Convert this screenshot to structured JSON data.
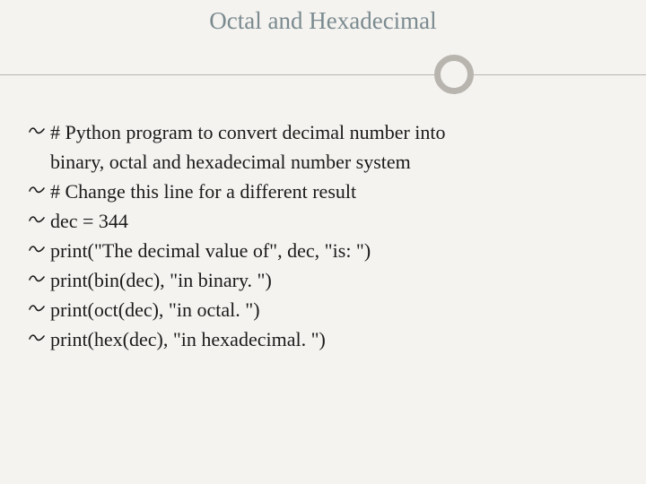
{
  "title": "Octal and Hexadecimal",
  "lines": [
    {
      "text": "# Python program to convert decimal number into",
      "bullet": true,
      "indent": false
    },
    {
      "text": "binary, octal and hexadecimal number system",
      "bullet": false,
      "indent": true
    },
    {
      "text": "# Change this line for a different result",
      "bullet": true,
      "indent": false
    },
    {
      "text": "dec = 344",
      "bullet": true,
      "indent": false
    },
    {
      "text": "print(\"The decimal value of\", dec, \"is: \")",
      "bullet": true,
      "indent": false
    },
    {
      "text": "print(bin(dec), \"in binary. \")",
      "bullet": true,
      "indent": false
    },
    {
      "text": "print(oct(dec), \"in octal. \")",
      "bullet": true,
      "indent": false
    },
    {
      "text": "print(hex(dec), \"in hexadecimal. \")",
      "bullet": true,
      "indent": false
    }
  ],
  "bullet_glyph": "ས"
}
